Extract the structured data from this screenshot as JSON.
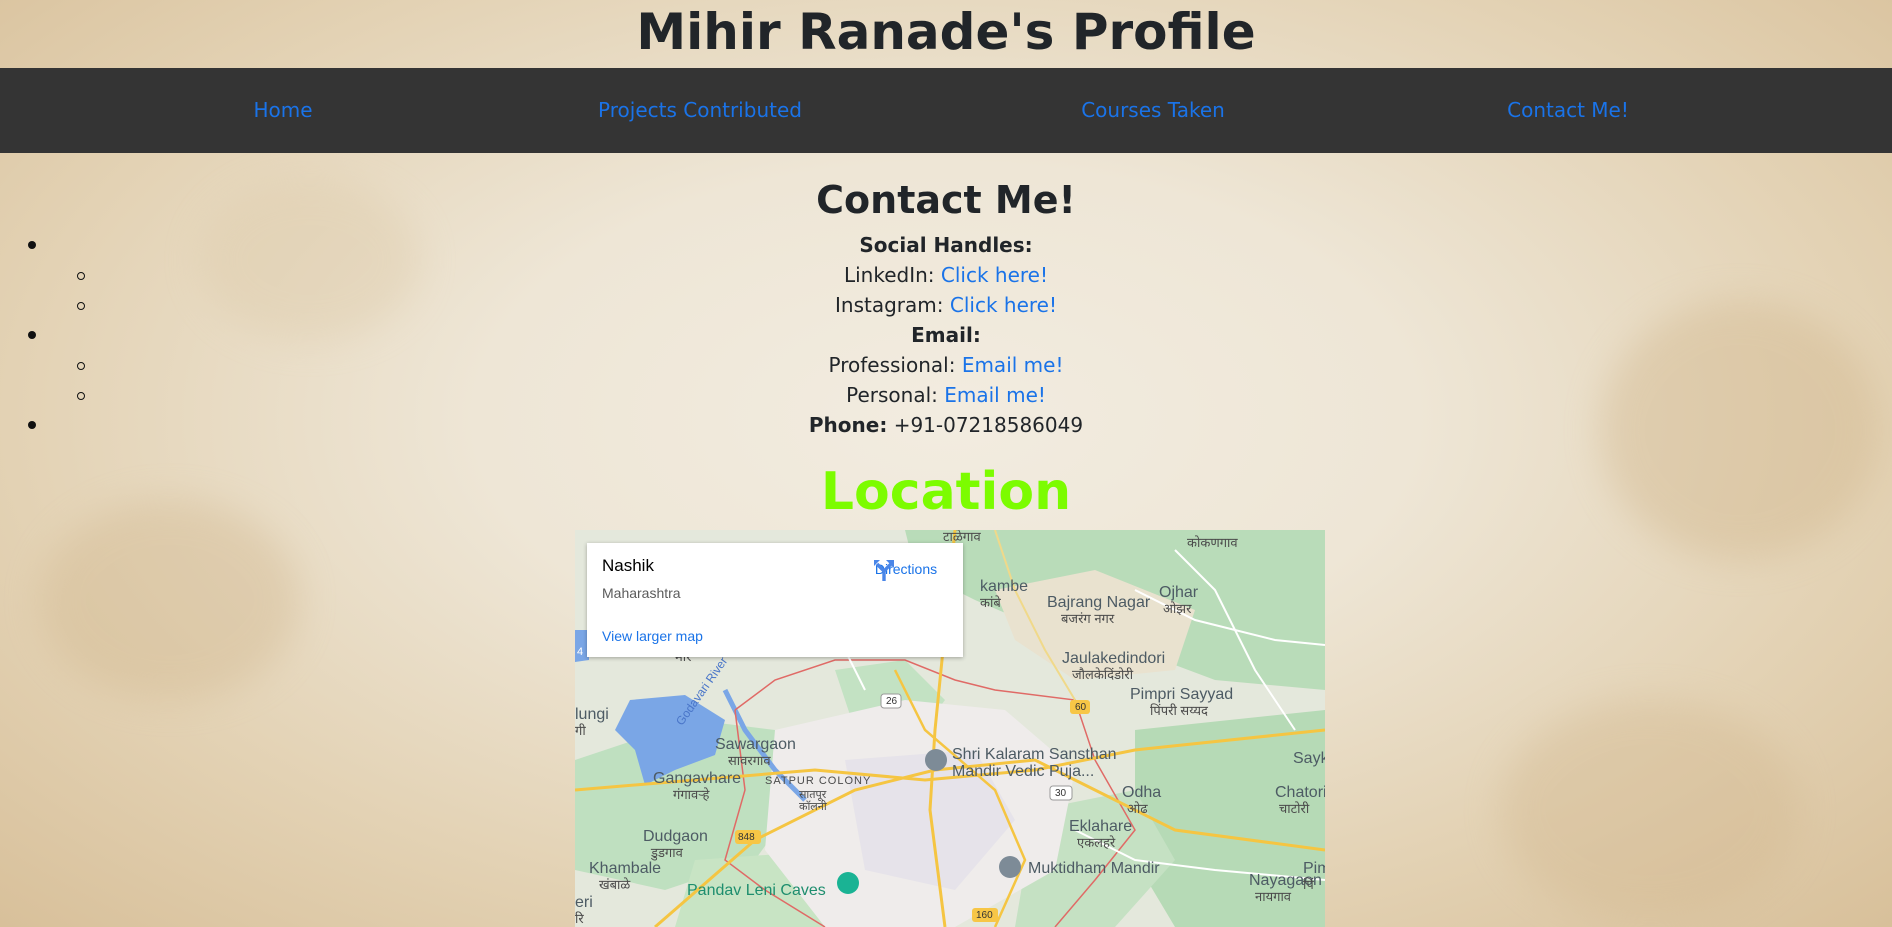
{
  "header": {
    "title": "Mihir Ranade's Profile"
  },
  "nav": {
    "items": [
      {
        "label": "Home"
      },
      {
        "label": "Projects Contributed"
      },
      {
        "label": "Courses Taken"
      },
      {
        "label": "Contact Me!"
      }
    ]
  },
  "contact": {
    "title": "Contact Me!",
    "social_heading": "Social Handles:",
    "linkedin_label": "LinkedIn:",
    "linkedin_link": "Click here!",
    "instagram_label": "Instagram:",
    "instagram_link": "Click here!",
    "email_heading": "Email:",
    "professional_label": "Professional:",
    "professional_link": "Email me!",
    "personal_label": "Personal:",
    "personal_link": "Email me!",
    "phone_label": "Phone:",
    "phone_value": "+91-07218586049"
  },
  "location": {
    "title": "Location",
    "title_color": "#7cfc00",
    "map": {
      "place": "Nashik",
      "region": "Maharashtra",
      "directions_label": "Directions",
      "larger_map_label": "View larger map",
      "labels": {
        "talegaon": "टाळेगाव",
        "kokangaon": "कोकणगाव",
        "kambe": "kambe",
        "kambe_mr": "कांबे",
        "bajrang": "Bajrang Nagar",
        "bajrang_mr": "बजरंग नगर",
        "ojhar": "Ojhar",
        "ojhar_mr": "ओझर",
        "jaulake": "Jaulakedindori",
        "jaulake_mr": "जौलकेदिंडोरी",
        "pimpri": "Pimpri Sayyad",
        "pimpri_mr": "पिंपरी सय्यद",
        "shri": "Shri Kalaram Sansthan",
        "shri2": "Mandir Vedic Puja...",
        "sawargaon": "Sawargaon",
        "sawargaon_mr": "सावरगाव",
        "satpur": "SATPUR COLONY",
        "satpur_mr": "सातपूर",
        "satpur_mr2": "कॉलनी",
        "gangavhare": "Gangavhare",
        "gangavhare_mr": "गंगावऱ्हे",
        "godavari": "Godavari River",
        "lungi": "lungi",
        "lungi_mr": "गी",
        "odha": "Odha",
        "odha_mr": "ओढ",
        "eklahare": "Eklahare",
        "eklahare_mr": "एकलहरे",
        "sayk": "Saykl",
        "chatori": "Chatori",
        "chatori_mr": "चाटोरी",
        "dudgaon": "Dudgaon",
        "dudgaon_mr": "डुडगाव",
        "khambale": "Khambale",
        "khambale_mr": "खंबाळे",
        "pandav": "Pandav Leni Caves",
        "muktidham": "Muktidham Mandir",
        "nayagaon": "Nayagaon",
        "nayagaon_mr": "नायगाव",
        "pimp": "Pimp",
        "pimp_mr": "पिं",
        "eri": "eri",
        "eri_mr": "रि",
        "mhir": "मीर",
        "nh26": "26",
        "nh60": "60",
        "nh30": "30",
        "nh848": "848",
        "nh160": "160",
        "nh_left": "4"
      }
    }
  }
}
